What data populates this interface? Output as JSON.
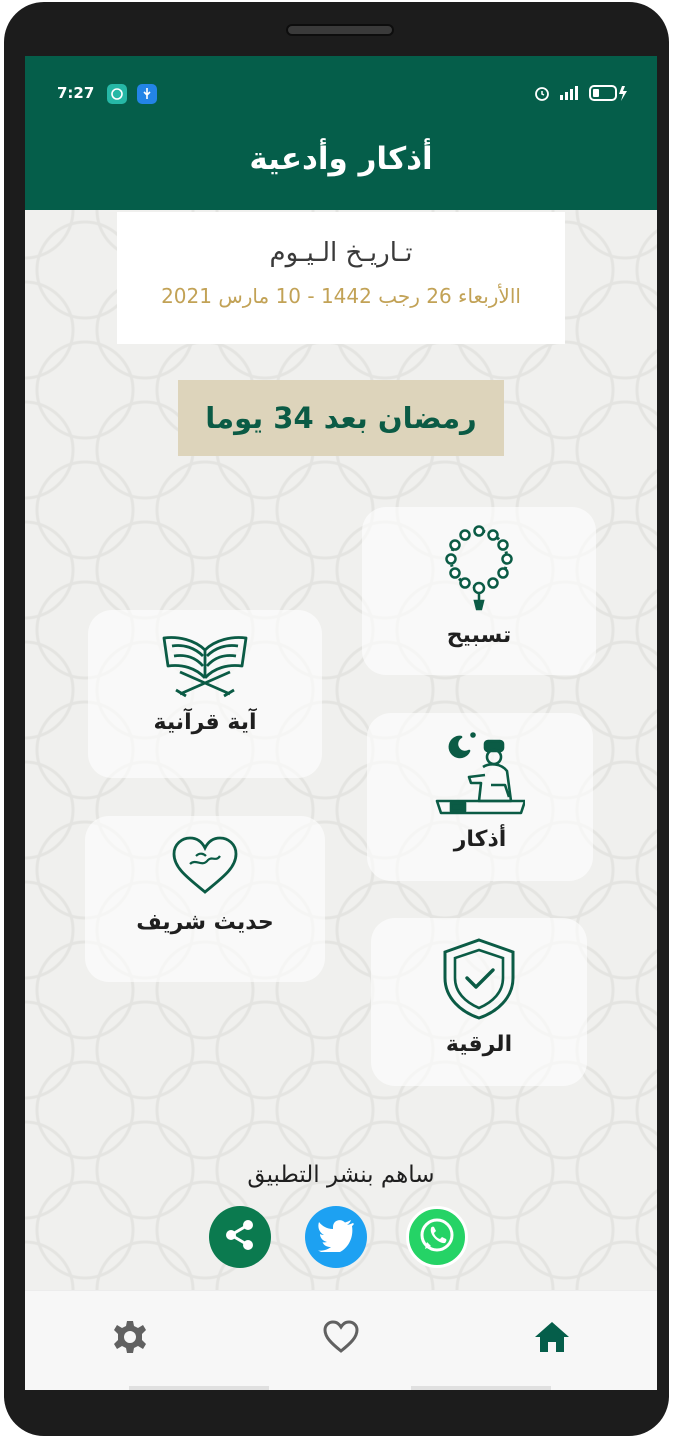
{
  "status": {
    "time": "7:27"
  },
  "appbar": {
    "title": "أذكار وأدعية"
  },
  "date_card": {
    "title": "تـاريـخ الـيـوم",
    "value": "االأربعاء 26 رجب 1442 - 10 مارس 2021"
  },
  "countdown": {
    "label": "رمضان  بعد 34 يوما"
  },
  "tiles": [
    {
      "label": "تسبيح",
      "icon": "prayer-beads-icon"
    },
    {
      "label": "آية قرآنية",
      "icon": "quran-icon"
    },
    {
      "label": "أذكار",
      "icon": "praying-man-icon"
    },
    {
      "label": "حديث شريف",
      "icon": "heart-muhammad-icon"
    },
    {
      "label": "الرقية",
      "icon": "shield-check-icon"
    }
  ],
  "share": {
    "label": "ساهم بنشر التطبيق",
    "buttons": [
      "share-icon",
      "twitter-icon",
      "whatsapp-icon"
    ]
  },
  "bottom_nav": [
    "settings-icon",
    "heart-icon",
    "home-icon"
  ],
  "colors": {
    "primary": "#055e4a",
    "gold": "#c2a256",
    "banner": "#ddd4bb",
    "twitter": "#1da1f2",
    "whatsapp": "#25d366"
  }
}
